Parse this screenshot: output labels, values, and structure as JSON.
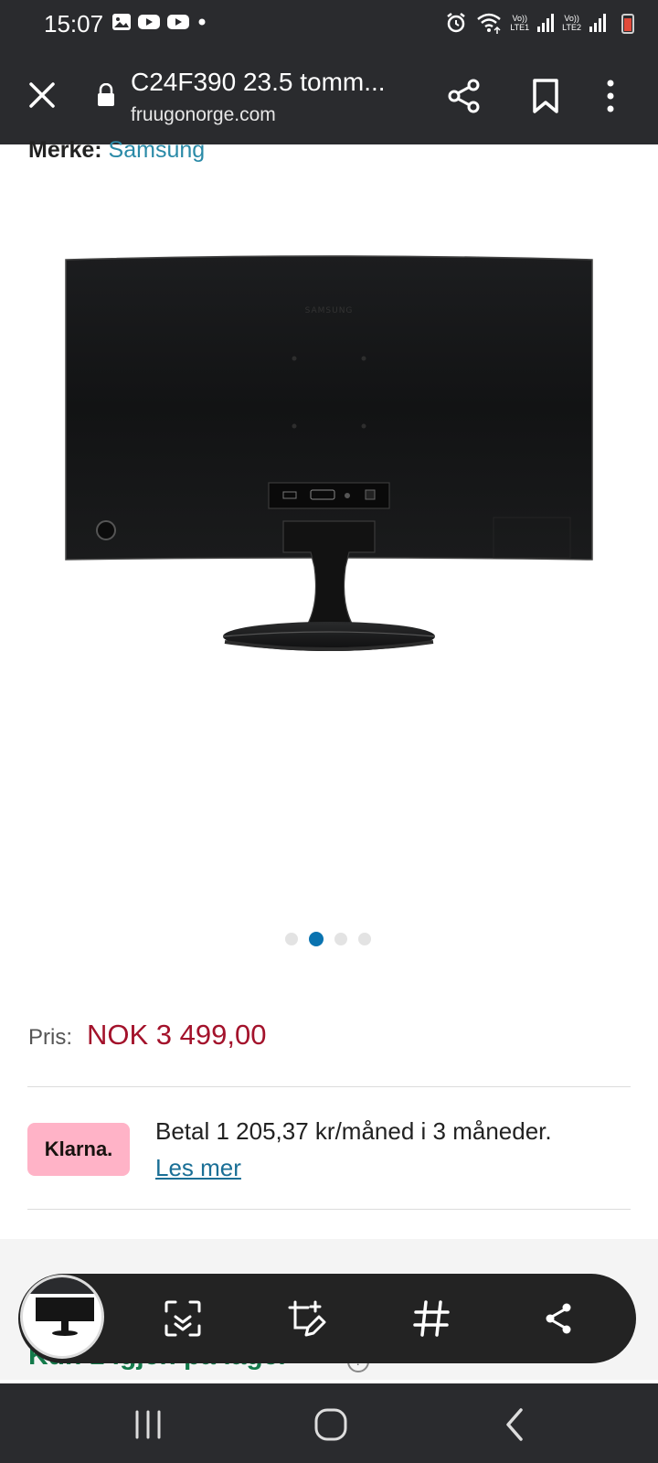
{
  "status_bar": {
    "time": "15:07",
    "left_icons": [
      "gallery-icon",
      "youtube-icon",
      "youtube-icon",
      "dot-icon"
    ],
    "sim1_label": "Vo))",
    "sim1_sub": "LTE1",
    "sim2_label": "Vo))",
    "sim2_sub": "LTE2"
  },
  "browser": {
    "page_title": "C24F390 23.5 tomm...",
    "domain": "fruugonorge.com"
  },
  "product": {
    "brand_label": "Merke:",
    "brand_value": "Samsung",
    "carousel": {
      "count": 4,
      "active_index": 1
    }
  },
  "price": {
    "label": "Pris:",
    "value": "NOK 3 499,00"
  },
  "klarna": {
    "badge": "Klarna.",
    "text": "Betal 1 205,37 kr/måned i 3 måneder.",
    "link": "Les mer"
  },
  "stock": {
    "text": "Kun 1 igjen på lager"
  },
  "capture_toolbar": {
    "buttons": [
      "scan-text-icon",
      "edit-crop-icon",
      "hashtag-icon",
      "share-icon"
    ]
  },
  "colors": {
    "bar_dark": "#2a2b2e",
    "price_red": "#a3122b",
    "link_blue": "#1a6f96",
    "klarna_pink": "#ffb3c7",
    "stock_green": "#137a4a",
    "dot_active": "#0a73b0"
  }
}
